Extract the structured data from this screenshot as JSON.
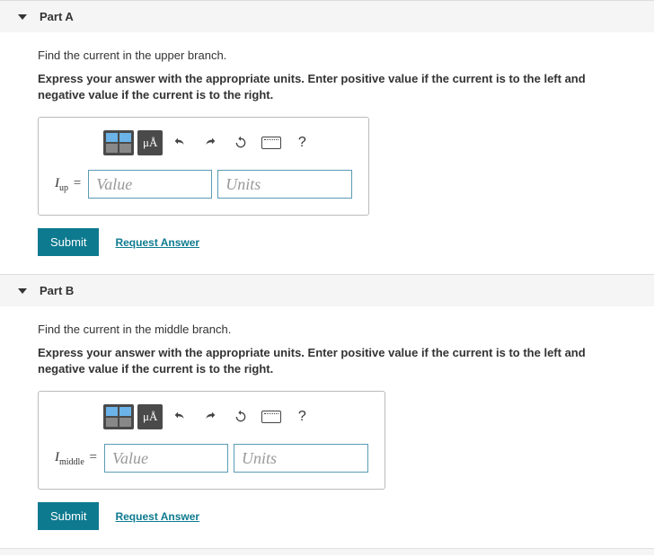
{
  "parts": [
    {
      "title": "Part A",
      "prompt": "Find the current in the upper branch.",
      "instructions": "Express your answer with the appropriate units. Enter positive value if the current is to the left and negative value if the current is to the right.",
      "varSymbol": "I",
      "varSubscript": "up",
      "valuePlaceholder": "Value",
      "unitsPlaceholder": "Units",
      "toolbar": {
        "uA": "μÅ",
        "help": "?"
      },
      "submitLabel": "Submit",
      "requestLabel": "Request Answer"
    },
    {
      "title": "Part B",
      "prompt": "Find the current in the middle branch.",
      "instructions": "Express your answer with the appropriate units. Enter positive value if the current is to the left and negative value if the current is to the right.",
      "varSymbol": "I",
      "varSubscript": "middle",
      "valuePlaceholder": "Value",
      "unitsPlaceholder": "Units",
      "toolbar": {
        "uA": "μÅ",
        "help": "?"
      },
      "submitLabel": "Submit",
      "requestLabel": "Request Answer"
    }
  ]
}
